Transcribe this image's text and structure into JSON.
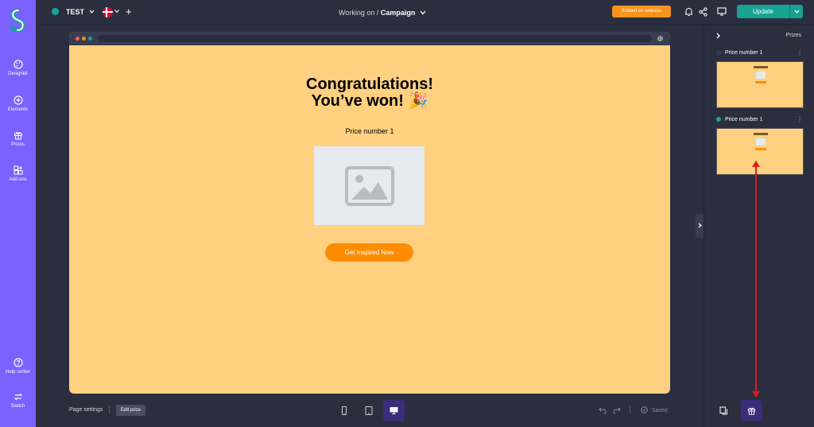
{
  "sidebar": {
    "items": [
      {
        "label": "Designkit",
        "icon": "palette-icon"
      },
      {
        "label": "Elements",
        "icon": "plus-circle-icon"
      },
      {
        "label": "Prizes",
        "icon": "gift-icon"
      },
      {
        "label": "Add-ons",
        "icon": "add-ons-icon"
      }
    ],
    "bottom": [
      {
        "label": "Help center",
        "icon": "question-icon"
      },
      {
        "label": "Switch",
        "icon": "switch-icon"
      }
    ]
  },
  "topbar": {
    "project_name": "TEST",
    "add_label": "+",
    "working_on_prefix": "Working on  /",
    "working_on_page": "Campaign",
    "embed_label": "Embed on website",
    "update_label": "Update"
  },
  "canvas": {
    "title_line1": "Congratulations!",
    "title_line2": "You’ve won! 🎉",
    "prize_name": "Price number 1",
    "cta_label": "Get Inspired Now"
  },
  "bottombar": {
    "page_settings": "Page settings",
    "edit_prize": "Edit prize",
    "saved": "Saved"
  },
  "right_panel": {
    "title": "Prizes",
    "prizes": [
      {
        "name": "Price number 1",
        "dot_color": "#3a3d50"
      },
      {
        "name": "Price number 1",
        "dot_color": "#16a394"
      }
    ]
  },
  "colors": {
    "sidebar": "#7b61ff",
    "background": "#2b2e3f",
    "canvas": "#ffd07f",
    "accent_teal": "#16a394",
    "cta_orange": "#ff8c00",
    "annotation_red": "#e01b1b"
  }
}
